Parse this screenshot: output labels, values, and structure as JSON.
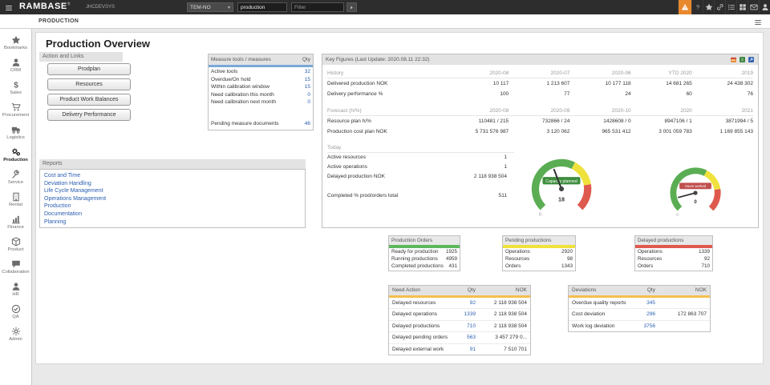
{
  "topbar": {
    "logo": "RAMBASE",
    "logo_mark": "®",
    "system_id": "JHCDEVSYS",
    "module_select": {
      "value": "TEM-NO"
    },
    "program_input": {
      "value": "production"
    },
    "filter_input": {
      "placeholder": "Filter"
    },
    "action_icons": [
      {
        "icon": "warning",
        "accent": true
      },
      {
        "icon": "question"
      },
      {
        "icon": "star"
      },
      {
        "icon": "link"
      },
      {
        "icon": "list"
      },
      {
        "icon": "grid"
      },
      {
        "icon": "mail"
      },
      {
        "icon": "person"
      }
    ]
  },
  "breadcrumb": {
    "label": "PRODUCTION"
  },
  "sidebar": {
    "items": [
      {
        "label": "Bookmarks",
        "icon": "star"
      },
      {
        "label": "CRM",
        "icon": "person"
      },
      {
        "label": "Sales",
        "icon": "dollar"
      },
      {
        "label": "Procurement",
        "icon": "cart"
      },
      {
        "label": "Logistics",
        "icon": "truck"
      },
      {
        "label": "Production",
        "icon": "gears",
        "active": true
      },
      {
        "label": "Service",
        "icon": "wrench"
      },
      {
        "label": "Rental",
        "icon": "building"
      },
      {
        "label": "Finance",
        "icon": "chart"
      },
      {
        "label": "Product",
        "icon": "box"
      },
      {
        "label": "Collaboration",
        "icon": "chat"
      },
      {
        "label": "HR",
        "icon": "person"
      },
      {
        "label": "QA",
        "icon": "check"
      },
      {
        "label": "Admin",
        "icon": "gear"
      }
    ]
  },
  "page": {
    "title": "Production Overview"
  },
  "actions": {
    "header": "Action and Links",
    "buttons": [
      "Prodplan",
      "Resources",
      "Product Work Balances",
      "Delivery Performance"
    ]
  },
  "reports": {
    "header": "Reports",
    "links": [
      "Cost and Time",
      "Deviation Handling",
      "Life Cycle Management",
      "Operations Management",
      "Production",
      "Documentation",
      "Planning"
    ]
  },
  "measure_tools": {
    "header": "Measure tools / measures",
    "qty_label": "Qty",
    "rows": [
      {
        "label": "Active tools",
        "qty": "32"
      },
      {
        "label": "Overdue/On hold",
        "qty": "15"
      },
      {
        "label": "Within calibration window",
        "qty": "15"
      },
      {
        "label": "Need calibration this month",
        "qty": "0"
      },
      {
        "label": "Need calibration next month",
        "qty": "0"
      }
    ],
    "pending_row": {
      "label": "Pending measure documents",
      "qty": "46"
    }
  },
  "key_figures": {
    "header": "Key Figures (Last Update: 2020.08.11 22:32)",
    "header_icons": [
      "calendar",
      "excel",
      "export"
    ],
    "history": {
      "label": "History",
      "columns": [
        "2020-08",
        "2020-07",
        "2020-06",
        "YTD 2020",
        "2019"
      ],
      "rows": [
        {
          "label": "Delivered production NOK",
          "values": [
            "10 117",
            "1 213 607",
            "10 177 118",
            "14 681 265",
            "24 438 302"
          ]
        },
        {
          "label": "Delivery performance %",
          "values": [
            "100",
            "77",
            "24",
            "60",
            "76"
          ]
        }
      ]
    },
    "forecast": {
      "label": "Forecast (h/%)",
      "columns": [
        "2020-08",
        "2020-09",
        "2020-10",
        "2020",
        "2021"
      ],
      "rows": [
        {
          "label": "Resource plan h/%",
          "values": [
            "110481 / 215",
            "732866 / 24",
            "1428608 / 0",
            "8947106 / 1",
            "3871994 / 5"
          ]
        },
        {
          "label": "Production cost plan NOK",
          "values": [
            "5 731 576 987",
            "3 120 062",
            "965 531 412",
            "3 001 059 783",
            "1 169 855 143"
          ]
        }
      ]
    },
    "today": {
      "label": "Today",
      "rows": [
        {
          "label": "Active resources",
          "value": "1"
        },
        {
          "label": "Active operations",
          "value": "1"
        },
        {
          "label": "Delayed production NOK",
          "value": "2 118 938 504"
        },
        {
          "label": "Completed % prod/orders total",
          "value": "511"
        }
      ]
    },
    "gauges": [
      {
        "label": "Capacity planned",
        "value": "18",
        "min": "0",
        "band_color": "#3e8e3e"
      },
      {
        "label": "Hours worked",
        "value": "0",
        "min": "0",
        "band_color": "#c0504d"
      }
    ]
  },
  "status_cards": [
    {
      "title": "Production Orders",
      "color": "#5cb85c",
      "rows": [
        {
          "label": "Ready for production",
          "value": "1925"
        },
        {
          "label": "Running productions",
          "value": "4959"
        },
        {
          "label": "Completed productions",
          "value": "431"
        }
      ]
    },
    {
      "title": "Pending productions",
      "color": "#efe23d",
      "rows": [
        {
          "label": "Operations",
          "value": "2920"
        },
        {
          "label": "Resources",
          "value": "98"
        },
        {
          "label": "Orders",
          "value": "1343"
        }
      ]
    },
    {
      "title": "Delayed productions",
      "color": "#df5a4e",
      "rows": [
        {
          "label": "Operations",
          "value": "1339"
        },
        {
          "label": "Resources",
          "value": "92"
        },
        {
          "label": "Orders",
          "value": "710"
        }
      ]
    }
  ],
  "need_action": {
    "title": "Need Action",
    "qty_label": "Qty",
    "nok_label": "NOK",
    "color": "#f5c04e",
    "rows": [
      {
        "label": "Delayed resources",
        "qty": "92",
        "nok": "2 118 938 504"
      },
      {
        "label": "Delayed operations",
        "qty": "1339",
        "nok": "2 118 938 504"
      },
      {
        "label": "Delayed productions",
        "qty": "710",
        "nok": "2 118 938 504"
      },
      {
        "label": "Delayed pending orders",
        "qty": "563",
        "nok": "3 457 279 0..."
      },
      {
        "label": "Delayed external work",
        "qty": "91",
        "nok": "7 510 701"
      }
    ]
  },
  "deviations": {
    "title": "Deviations",
    "qty_label": "Qty",
    "nok_label": "NOK",
    "color": "#f5c04e",
    "rows": [
      {
        "label": "Overdue quality reports",
        "qty": "345",
        "nok": ""
      },
      {
        "label": "Cost deviation",
        "qty": "296",
        "nok": "172 863 707"
      },
      {
        "label": "Work log deviation",
        "qty": "3756",
        "nok": ""
      }
    ]
  }
}
